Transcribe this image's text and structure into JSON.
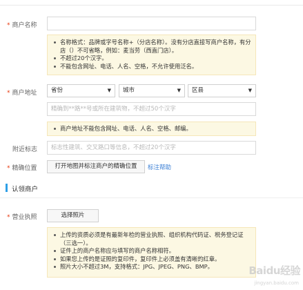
{
  "merchant_name": {
    "label": "商户名称",
    "value": "",
    "notes": [
      "名称格式：品牌或字号名称+（分店名称）。没有分店直接写商户名称，有分店（）不可省略，例如：麦当劳（西直门店）。",
      "不超过20个汉字。",
      "不能包含网址、电话、人名、空格，不允许使用泛名。"
    ]
  },
  "merchant_address": {
    "label": "商户地址",
    "province": "省份",
    "city": "城市",
    "district": "区县",
    "detail_placeholder": "精确到**路**号或所在建筑物，不超过50个汉字",
    "notes": [
      "商户地址不能包含网址、电话、人名、空格、邮编。"
    ]
  },
  "nearby_landmark": {
    "label": "附近标志",
    "placeholder": "标志性建筑、交叉路口等信息，不超过20个汉字"
  },
  "precise_location": {
    "label": "精确位置",
    "button": "打开地图并标注商户的精确位置",
    "help_link": "标注帮助"
  },
  "claim_section": {
    "title": "认领商户"
  },
  "business_license": {
    "label": "营业执照",
    "button": "选择照片",
    "notes": [
      "上传的资质必须是有最新年检的营业执照、组织机构代码证、税务登记证（三选一）。",
      "证件上的商户名称应与填写的商户名称相符。",
      "如果您上传的是证照的复印件，复印件上必须盖有清晰的红章。",
      "照片大小不超过3M，支持格式：JPG、JPEG、PNG、BMP。"
    ]
  },
  "watermark": {
    "text": "Baidu经验",
    "sub": "jingyan.baidu.com"
  },
  "colors": {
    "required": "#e8380d",
    "notice_bg": "#fcf8e3",
    "link": "#3a7fd5",
    "section_accent": "#2e9fe6"
  }
}
